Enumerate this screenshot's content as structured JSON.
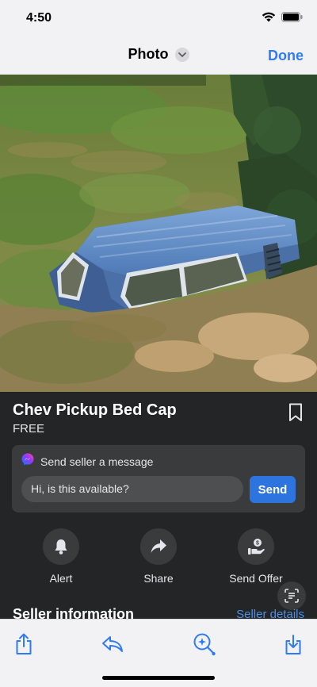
{
  "status_bar": {
    "time": "4:50",
    "icons": [
      "wifi-icon",
      "battery-icon"
    ]
  },
  "nav": {
    "title": "Photo",
    "done_label": "Done"
  },
  "photo": {
    "subject": "blue pickup bed cap on a grassy hillside"
  },
  "listing": {
    "title": "Chev Pickup Bed Cap",
    "price": "FREE"
  },
  "message": {
    "heading": "Send seller a message",
    "input_value": "Hi, is this available?",
    "send_label": "Send"
  },
  "actions": [
    {
      "label": "Alert",
      "icon": "bell-icon"
    },
    {
      "label": "Share",
      "icon": "share-arrow-icon"
    },
    {
      "label": "Send Offer",
      "icon": "offer-hand-icon"
    }
  ],
  "seller": {
    "heading": "Seller information",
    "details_link": "Seller details"
  },
  "toolbar": {
    "icons": [
      "share-icon",
      "reply-icon",
      "visual-lookup-icon",
      "download-icon"
    ]
  },
  "colors": {
    "accent": "#2f7bf6",
    "panel_bg": "#242526",
    "card_bg": "#3a3b3c",
    "send_button": "#2d74de"
  }
}
